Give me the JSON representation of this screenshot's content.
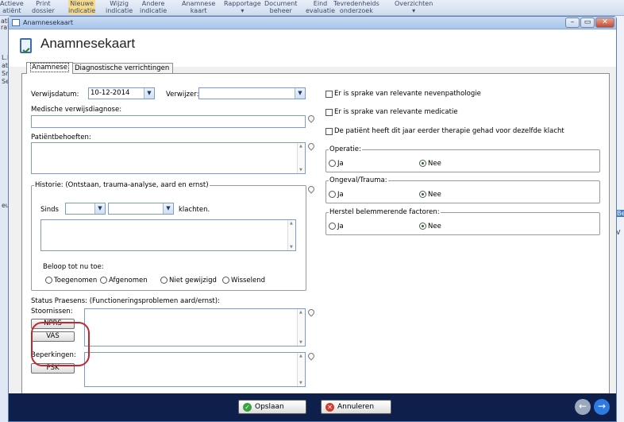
{
  "background_app": {
    "ribbon_items": [
      {
        "top": "Actieve",
        "bottom": "atiënt"
      },
      {
        "top": "Print",
        "bottom": "dossier"
      },
      {
        "top": "Nieuwe",
        "bottom": "indicatie"
      },
      {
        "top": "Wijzig",
        "bottom": "indicatie"
      },
      {
        "top": "Andere",
        "bottom": "indicatie"
      },
      {
        "top": "Anamnese",
        "bottom": "kaart"
      },
      {
        "top": "Rapportage",
        "bottom": "▾"
      },
      {
        "top": "Document",
        "bottom": "beheer"
      },
      {
        "top": "Eind",
        "bottom": "evaluatie"
      },
      {
        "top": "Tevredenheids",
        "bottom": "onderzoek"
      },
      {
        "top": "Overzichten",
        "bottom": "▾"
      }
    ],
    "left_snippets": [
      "atiënt",
      "ratie",
      "L.M",
      "at",
      "Sm",
      "Se",
      "eu"
    ],
    "right_snippets": [
      "Be",
      "V"
    ]
  },
  "window": {
    "title": "Anamnesekaart",
    "header_title": "Anamnesekaart",
    "controls": {
      "minimize": "–",
      "maximize": "▭",
      "close": "✕"
    }
  },
  "tabs": [
    {
      "label": "Anamnese",
      "active": true
    },
    {
      "label": "Diagnostische verrichtingen",
      "active": false
    }
  ],
  "form": {
    "verwijsdatum_label": "Verwijsdatum:",
    "verwijsdatum_value": "10-12-2014",
    "verwijzer_label": "Verwijzer:",
    "verwijzer_value": "",
    "medische_label": "Medische verwijsdiagnose:",
    "patient_label": "Patiëntbehoeften:",
    "historie_legend": "Historie: (Ontstaan, trauma-analyse, aard en ernst)",
    "sinds_label": "Sinds",
    "klachten_label": "klachten.",
    "beloop_label": "Beloop tot nu toe:",
    "beloop_options": [
      "Toegenomen",
      "Afgenomen",
      "Niet gewijzigd",
      "Wisselend"
    ],
    "status_label": "Status Praesens: (Functioneringsproblemen aard/ernst):",
    "stoornissen_label": "Stoornissen:",
    "nprs_button": "NPRS",
    "vas_button": "VAS",
    "beperkingen_label": "Beperkingen:",
    "psk_button": "PSK",
    "checks": [
      {
        "label": "Er is sprake van relevante nevenpathologie",
        "checked": false
      },
      {
        "label": "Er is sprake van relevante medicatie",
        "checked": false
      },
      {
        "label": "De patiënt heeft dit jaar eerder therapie gehad voor dezelfde klacht",
        "checked": false
      }
    ],
    "groups": [
      {
        "legend": "Operatie:",
        "ja": "Ja",
        "nee": "Nee",
        "selected": "Nee"
      },
      {
        "legend": "Ongeval/Trauma:",
        "ja": "Ja",
        "nee": "Nee",
        "selected": "Nee"
      },
      {
        "legend": "Herstel belemmerende factoren:",
        "ja": "Ja",
        "nee": "Nee",
        "selected": "Nee"
      }
    ]
  },
  "footer": {
    "save_label": "Opslaan",
    "cancel_label": "Annuleren",
    "colors": {
      "save": "#3aa23a",
      "cancel": "#d23b2f",
      "nav_back": "#9aa8bd",
      "nav_forward": "#2d7be0"
    }
  }
}
